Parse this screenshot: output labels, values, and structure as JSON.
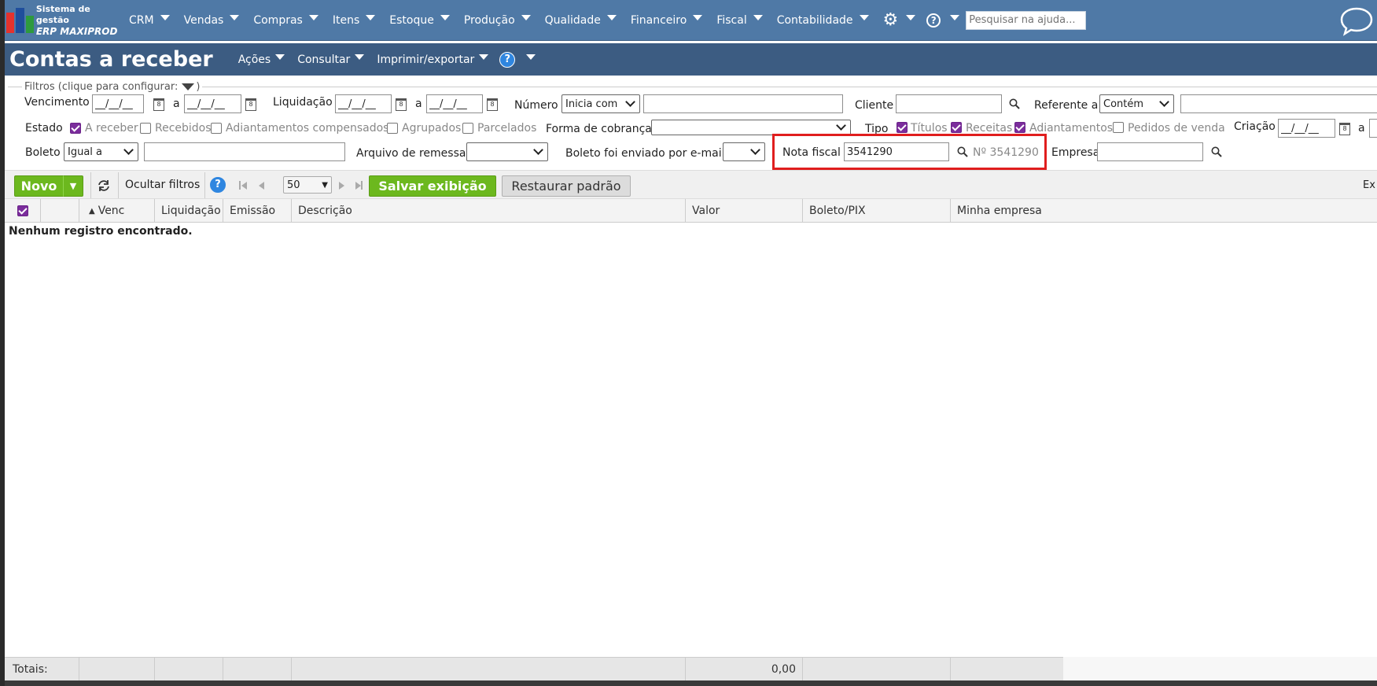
{
  "topnav": {
    "logo_line1": "Sistema de gestão",
    "logo_line2": "ERP MAXIPROD",
    "menu": [
      "CRM",
      "Vendas",
      "Compras",
      "Itens",
      "Estoque",
      "Produção",
      "Qualidade",
      "Financeiro",
      "Fiscal",
      "Contabilidade"
    ],
    "help_search_placeholder": "Pesquisar na ajuda..."
  },
  "page": {
    "title": "Contas a receber",
    "actions": [
      "Ações",
      "Consultar",
      "Imprimir/exportar"
    ]
  },
  "filters": {
    "legend": "Filtros (clique para configurar:",
    "legend_close": ")",
    "vencimento": "Vencimento",
    "liquidacao": "Liquidação",
    "date_mask": "__/__/__",
    "a": "a",
    "numero": "Número",
    "numero_mode": "Inicia com",
    "cliente": "Cliente",
    "referente_a": "Referente a",
    "referente_mode": "Contém",
    "estado": "Estado",
    "estado_options": [
      "A receber",
      "Recebidos",
      "Adiantamentos compensados",
      "Agrupados",
      "Parcelados"
    ],
    "forma_cobranca": "Forma de cobrança",
    "tipo": "Tipo",
    "tipo_options": [
      "Títulos",
      "Receitas",
      "Adiantamentos",
      "Pedidos de venda"
    ],
    "criacao": "Criação",
    "boleto": "Boleto",
    "boleto_mode": "Igual a",
    "arquivo_remessa": "Arquivo de remessa",
    "boleto_email": "Boleto foi enviado por e-mail",
    "nota_fiscal": "Nota fiscal",
    "nota_fiscal_value": "3541290",
    "nota_fiscal_info": "Nº 3541290",
    "empresa": "Empresa"
  },
  "toolbar": {
    "novo": "Novo",
    "ocultar_filtros": "Ocultar filtros",
    "page_size": "50",
    "salvar_exibicao": "Salvar exibição",
    "restaurar_padrao": "Restaurar padrão",
    "ex": "Ex"
  },
  "table": {
    "sort_column": "Venc",
    "columns": [
      "Liquidação",
      "Emissão",
      "Descrição",
      "Valor",
      "Boleto/PIX",
      "Minha empresa"
    ],
    "empty_message": "Nenhum registro encontrado.",
    "totals_label": "Totais:",
    "total_value": "0,00"
  }
}
